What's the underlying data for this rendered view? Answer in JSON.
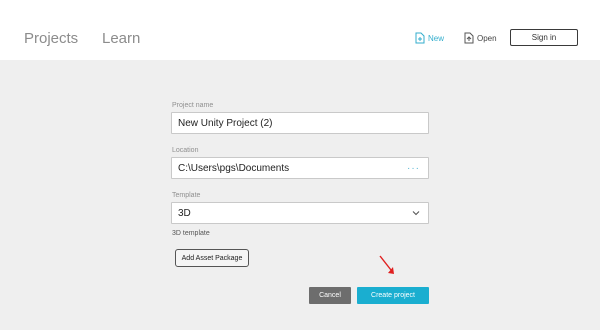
{
  "header": {
    "tabs": [
      {
        "label": "Projects"
      },
      {
        "label": "Learn"
      }
    ],
    "actions": {
      "new_label": "New",
      "open_label": "Open",
      "signin_label": "Sign in"
    }
  },
  "form": {
    "project_name": {
      "label": "Project name",
      "value": "New Unity Project (2)"
    },
    "location": {
      "label": "Location",
      "value": "C:\\Users\\pgs\\Documents",
      "browse_icon": "ellipsis-icon"
    },
    "template": {
      "label": "Template",
      "value": "3D",
      "description": "3D template"
    },
    "add_asset_package_label": "Add Asset Package"
  },
  "buttons": {
    "cancel_label": "Cancel",
    "create_label": "Create project"
  },
  "colors": {
    "accent": "#1aaed0",
    "cancel": "#6d6d6d",
    "annotation_arrow": "#e02020"
  }
}
